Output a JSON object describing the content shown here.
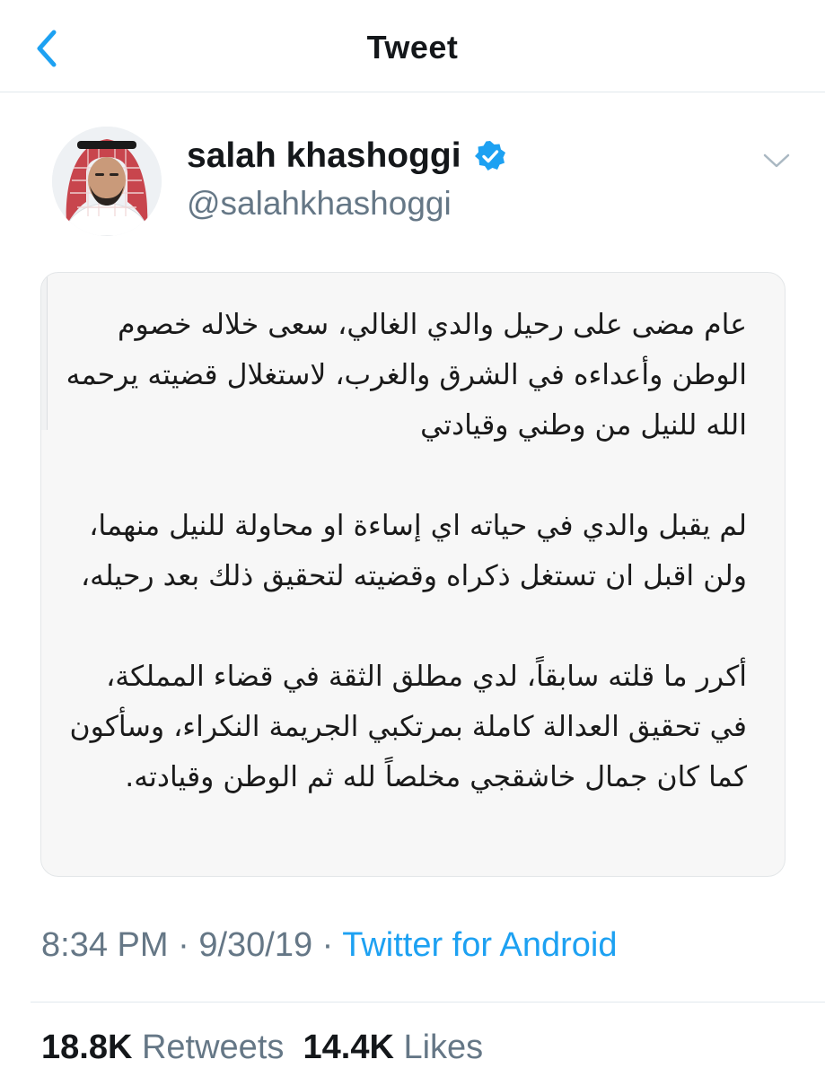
{
  "header": {
    "title": "Tweet",
    "back_icon": "chevron-left-icon"
  },
  "author": {
    "display_name": "salah khashoggi",
    "handle": "@salahkhashoggi",
    "verified_icon": "verified-badge-icon",
    "avatar": "avatar-photo"
  },
  "tweet": {
    "paragraphs": [
      "عام مضى على رحيل والدي الغالي، سعى خلاله خصوم الوطن وأعداءه في الشرق والغرب، لاستغلال قضيته يرحمه الله للنيل من وطني وقيادتي",
      "لم يقبل والدي في حياته اي إساءة او محاولة للنيل منهما، ولن اقبل ان تستغل ذكراه وقضيته لتحقيق ذلك بعد رحيله،",
      "أكرر ما قلته سابقاً، لدي مطلق الثقة في قضاء المملكة، في تحقيق العدالة كاملة بمرتكبي الجريمة النكراء، وسأكون كما كان جمال خاشقجي مخلصاً لله ثم الوطن وقيادته."
    ]
  },
  "meta": {
    "time": "8:34 PM",
    "date": "9/30/19",
    "separator": "·",
    "source": "Twitter for Android"
  },
  "stats": {
    "retweets_count": "18.8K",
    "retweets_label": "Retweets",
    "likes_count": "14.4K",
    "likes_label": "Likes"
  },
  "colors": {
    "accent": "#1da1f2",
    "muted": "#657786",
    "text": "#14171a"
  }
}
